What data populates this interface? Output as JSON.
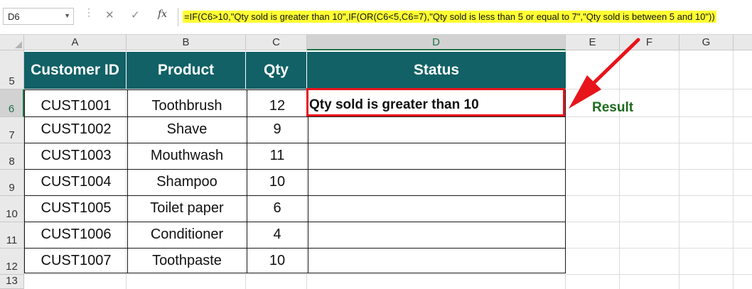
{
  "name_box": {
    "value": "D6"
  },
  "formula_bar": {
    "cancel_glyph": "✕",
    "confirm_glyph": "✓",
    "fx_label": "fx",
    "formula": "=IF(C6>10,\"Qty sold is greater than 10\",IF(OR(C6<5,C6=7),\"Qty sold is less than 5 or equal to 7\",\"Qty sold is between 5 and 10\"))"
  },
  "columns": [
    "A",
    "B",
    "C",
    "D",
    "E",
    "F",
    "G"
  ],
  "selected_column": "D",
  "rows": [
    "5",
    "6",
    "7",
    "8",
    "9",
    "10",
    "11",
    "12",
    "13"
  ],
  "selected_row": "6",
  "table": {
    "headers": [
      "Customer ID",
      "Product",
      "Qty",
      "Status"
    ],
    "rows": [
      {
        "customer_id": "CUST1001",
        "product": "Toothbrush",
        "qty": "12",
        "status": "Qty sold is greater than 10"
      },
      {
        "customer_id": "CUST1002",
        "product": "Shave",
        "qty": "9",
        "status": ""
      },
      {
        "customer_id": "CUST1003",
        "product": "Mouthwash",
        "qty": "11",
        "status": ""
      },
      {
        "customer_id": "CUST1004",
        "product": "Shampoo",
        "qty": "10",
        "status": ""
      },
      {
        "customer_id": "CUST1005",
        "product": "Toilet paper",
        "qty": "6",
        "status": ""
      },
      {
        "customer_id": "CUST1006",
        "product": "Conditioner",
        "qty": "4",
        "status": ""
      },
      {
        "customer_id": "CUST1007",
        "product": "Toothpaste",
        "qty": "10",
        "status": ""
      }
    ]
  },
  "annotation": {
    "label": "Result",
    "color": "#1e6b1e",
    "arrow_color": "#e8141b"
  },
  "colors": {
    "header_fill": "#116166",
    "header_text": "#ffffff",
    "formula_highlight": "#ffff33",
    "selection_green": "#217346"
  }
}
